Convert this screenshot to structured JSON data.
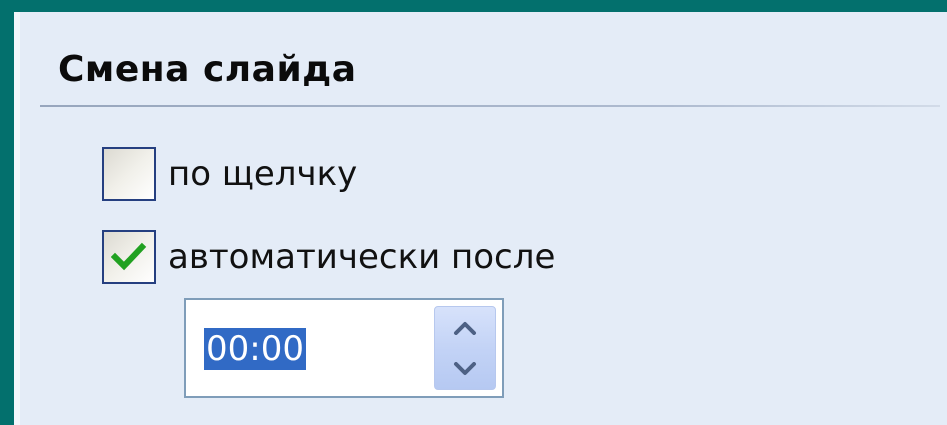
{
  "section": {
    "title": "Смена слайда"
  },
  "options": {
    "on_click": {
      "label": "по щелчку",
      "checked": false
    },
    "automatic_after": {
      "label": "автоматически после",
      "checked": true
    }
  },
  "time_field": {
    "value": "00:00",
    "selected": true
  },
  "colors": {
    "background": "#03706d",
    "panel": "#e4ecf7",
    "checkbox_border": "#253f80",
    "checkmark": "#21a121",
    "selection": "#316ac5",
    "spin_arrow": "#4d6185"
  },
  "icons": {
    "checkmark": "checkmark-icon",
    "spin_up": "chevron-up-icon",
    "spin_down": "chevron-down-icon"
  }
}
